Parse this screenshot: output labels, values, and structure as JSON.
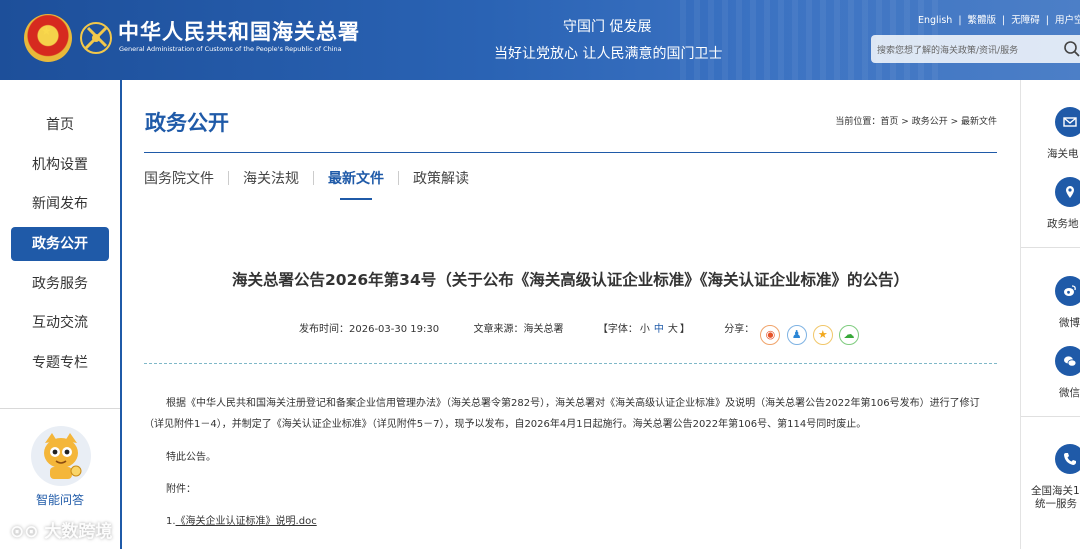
{
  "header": {
    "site_title_cn": "中华人民共和国海关总署",
    "site_title_en": "General Administration of Customs of the People's Republic of China",
    "slogan_line1": "守国门  促发展",
    "slogan_line2": "当好让党放心  让人民满意的国门卫士",
    "top_links": [
      "English",
      "繁體版",
      "无障碍",
      "用户空"
    ],
    "search_placeholder": "搜索您想了解的海关政策/资讯/服务"
  },
  "sidebar": {
    "items": [
      {
        "label": "首页"
      },
      {
        "label": "机构设置"
      },
      {
        "label": "新闻发布"
      },
      {
        "label": "政务公开",
        "active": true
      },
      {
        "label": "政务服务"
      },
      {
        "label": "互动交流"
      },
      {
        "label": "专题专栏"
      }
    ],
    "assistant_label": "智能问答"
  },
  "main": {
    "section_title": "政务公开",
    "breadcrumb": {
      "prefix": "当前位置：",
      "items": [
        "首页",
        "政务公开",
        "最新文件"
      ],
      "separator": " > "
    },
    "tabs": [
      {
        "label": "国务院文件"
      },
      {
        "label": "海关法规"
      },
      {
        "label": "最新文件",
        "active": true
      },
      {
        "label": "政策解读"
      }
    ],
    "article": {
      "title": "海关总署公告2026年第34号（关于公布《海关高级认证企业标准》《海关认证企业标准》的公告）",
      "publish_time_label": "发布时间：",
      "publish_time": "2026-03-30 19:30",
      "source_label": "文章来源：",
      "source": "海关总署",
      "font_label": "【字体：",
      "font_sizes": [
        "小",
        "中",
        "大"
      ],
      "font_close": "】",
      "share_label": "分享：",
      "paragraph1": "根据《中华人民共和国海关注册登记和备案企业信用管理办法》（海关总署令第282号），海关总署对《海关高级认证企业标准》及说明（海关总署公告2022年第106号发布）进行了修订（详见附件1－4），并制定了《海关认证企业标准》（详见附件5－7），现予以发布，自2026年4月1日起施行。海关总署公告2022年第106号、第114号同时废止。",
      "paragraph2": "特此公告。",
      "attachments_label": "附件：",
      "attachment1_num": "1.",
      "attachment1": "《海关企业认证标准》说明.doc"
    }
  },
  "rightbar": {
    "items": [
      {
        "label": "海关电",
        "icon": "mail-icon"
      },
      {
        "label": "政务地",
        "icon": "map-icon"
      },
      {
        "label": "微博",
        "icon": "weibo-icon"
      },
      {
        "label": "微信",
        "icon": "wechat-icon"
      },
      {
        "label_line1": "全国海关1",
        "label_line2": "统一服务",
        "icon": "phone-icon"
      }
    ]
  },
  "watermark": "大数跨境",
  "colors": {
    "brand_blue": "#1f5aa8",
    "header_blue": "#2a63b4",
    "dashed_rule": "#7fb8c8"
  }
}
